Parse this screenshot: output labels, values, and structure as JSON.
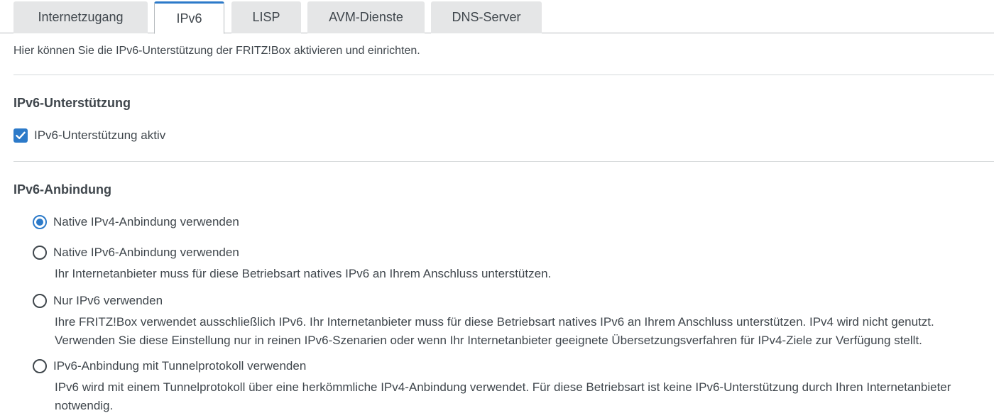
{
  "tabs": [
    {
      "label": "Internetzugang",
      "active": false
    },
    {
      "label": "IPv6",
      "active": true
    },
    {
      "label": "LISP",
      "active": false
    },
    {
      "label": "AVM-Dienste",
      "active": false
    },
    {
      "label": "DNS-Server",
      "active": false
    }
  ],
  "intro": "Hier können Sie die IPv6-Unterstützung der FRITZ!Box aktivieren und einrichten.",
  "support": {
    "title": "IPv6-Unterstützung",
    "checkbox_label": "IPv6-Unterstützung aktiv",
    "checked": true
  },
  "binding": {
    "title": "IPv6-Anbindung",
    "options": [
      {
        "label": "Native IPv4-Anbindung verwenden",
        "checked": true,
        "description": ""
      },
      {
        "label": "Native IPv6-Anbindung verwenden",
        "checked": false,
        "description": "Ihr Internetanbieter muss für diese Betriebsart natives IPv6 an Ihrem Anschluss unterstützen."
      },
      {
        "label": "Nur IPv6 verwenden",
        "checked": false,
        "description": "Ihre FRITZ!Box verwendet ausschließlich IPv6. Ihr Internetanbieter muss für diese Betriebsart natives IPv6 an Ihrem Anschluss unterstützen. IPv4 wird nicht genutzt. Verwenden Sie diese Einstellung nur in reinen IPv6-Szenarien oder wenn Ihr Internetanbieter geeignete Übersetzungsverfahren für IPv4-Ziele zur Verfügung stellt."
      },
      {
        "label": "IPv6-Anbindung mit Tunnelprotokoll verwenden",
        "checked": false,
        "description": "IPv6 wird mit einem Tunnelprotokoll über eine herkömmliche IPv4-Anbindung verwendet. Für diese Betriebsart ist keine IPv6-Unterstützung durch Ihren Internetanbieter notwendig."
      }
    ]
  },
  "colors": {
    "accent": "#2c7ac9",
    "text": "#3f464c",
    "tab_inactive": "#e5e6e7",
    "divider": "#d6d9db"
  }
}
